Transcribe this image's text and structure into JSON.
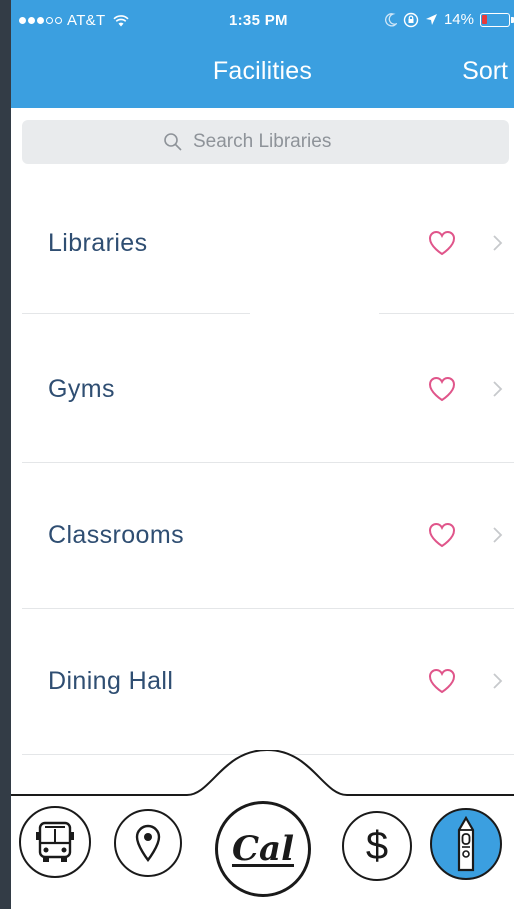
{
  "status_bar": {
    "carrier": "AT&T",
    "time": "1:35 PM",
    "battery": "14%"
  },
  "header": {
    "title": "Facilities",
    "sort_label": "Sort"
  },
  "search": {
    "placeholder": "Search Libraries"
  },
  "list": {
    "items": [
      {
        "label": "Libraries"
      },
      {
        "label": "Gyms"
      },
      {
        "label": "Classrooms"
      },
      {
        "label": "Dining Hall"
      }
    ]
  },
  "tabbar": {
    "cal_label": "Cal",
    "dollar_label": "$",
    "active_tab": "campanile"
  },
  "colors": {
    "accent": "#3b9fe0",
    "heart": "#e0558a",
    "text": "#2f4e72",
    "background": "#333c46"
  }
}
